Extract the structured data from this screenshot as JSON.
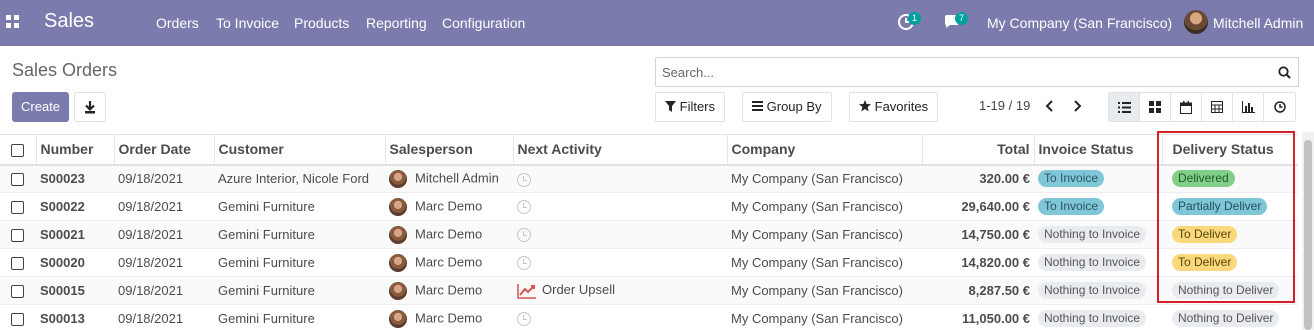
{
  "navbar": {
    "app_name": "Sales",
    "menu": [
      "Orders",
      "To Invoice",
      "Products",
      "Reporting",
      "Configuration"
    ],
    "activity_badge": "1",
    "messages_badge": "7",
    "company": "My Company (San Francisco)",
    "user": "Mitchell Admin",
    "color": "#7c7bad"
  },
  "control_panel": {
    "title": "Sales Orders",
    "create_label": "Create",
    "search_placeholder": "Search...",
    "filters_label": "Filters",
    "group_by_label": "Group By",
    "favorites_label": "Favorites",
    "pager": "1-19 / 19",
    "views": [
      "list-icon",
      "kanban-icon",
      "calendar-icon",
      "pivot-icon",
      "graph-icon",
      "activity-icon"
    ],
    "active_view": "list-icon"
  },
  "table": {
    "headers": {
      "number": "Number",
      "order_date": "Order Date",
      "customer": "Customer",
      "salesperson": "Salesperson",
      "next_activity": "Next Activity",
      "company": "Company",
      "total": "Total",
      "invoice_status": "Invoice Status",
      "delivery_status": "Delivery Status"
    },
    "rows": [
      {
        "number": "S00023",
        "date": "09/18/2021",
        "customer": "Azure Interior, Nicole Ford",
        "salesperson": "Mitchell Admin",
        "activity": "",
        "company": "My Company (San Francisco)",
        "total": "320.00 €",
        "invoice": "To Invoice",
        "delivery": "Delivered"
      },
      {
        "number": "S00022",
        "date": "09/18/2021",
        "customer": "Gemini Furniture",
        "salesperson": "Marc Demo",
        "activity": "",
        "company": "My Company (San Francisco)",
        "total": "29,640.00 €",
        "invoice": "To Invoice",
        "delivery": "Partially Deliver"
      },
      {
        "number": "S00021",
        "date": "09/18/2021",
        "customer": "Gemini Furniture",
        "salesperson": "Marc Demo",
        "activity": "",
        "company": "My Company (San Francisco)",
        "total": "14,750.00 €",
        "invoice": "Nothing to Invoice",
        "delivery": "To Deliver"
      },
      {
        "number": "S00020",
        "date": "09/18/2021",
        "customer": "Gemini Furniture",
        "salesperson": "Marc Demo",
        "activity": "",
        "company": "My Company (San Francisco)",
        "total": "14,820.00 €",
        "invoice": "Nothing to Invoice",
        "delivery": "To Deliver"
      },
      {
        "number": "S00015",
        "date": "09/18/2021",
        "customer": "Gemini Furniture",
        "salesperson": "Marc Demo",
        "activity": "Order Upsell",
        "company": "My Company (San Francisco)",
        "total": "8,287.50 €",
        "invoice": "Nothing to Invoice",
        "delivery": "Nothing to Deliver"
      },
      {
        "number": "S00013",
        "date": "09/18/2021",
        "customer": "Gemini Furniture",
        "salesperson": "Marc Demo",
        "activity": "",
        "company": "My Company (San Francisco)",
        "total": "11,050.00 €",
        "invoice": "Nothing to Invoice",
        "delivery": "Nothing to Deliver"
      }
    ]
  }
}
